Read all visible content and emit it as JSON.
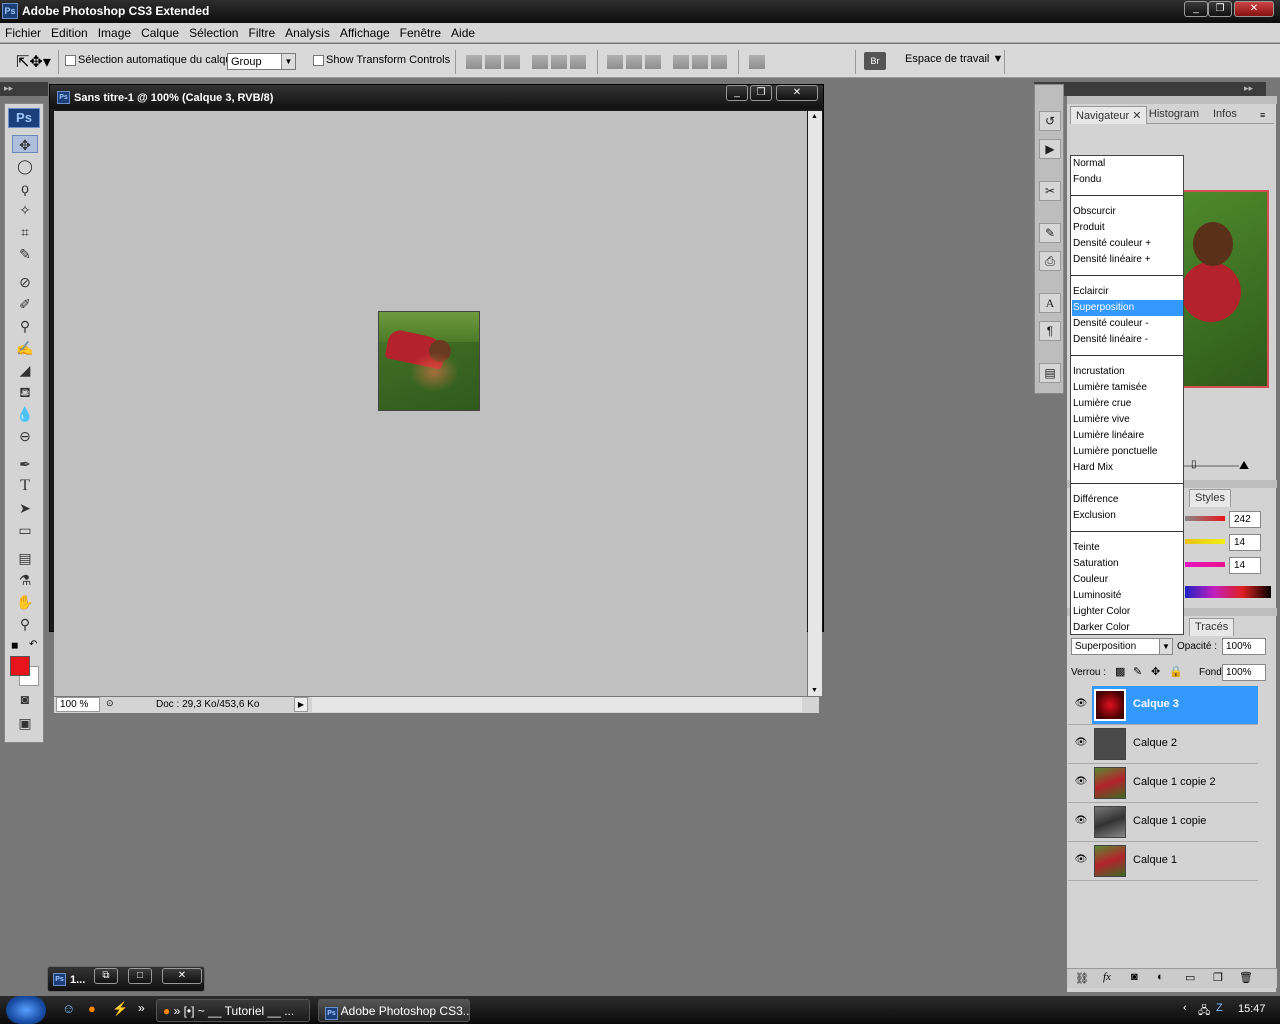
{
  "app": {
    "title": "Adobe Photoshop CS3 Extended",
    "logo": "Ps"
  },
  "menu": [
    "Fichier",
    "Edition",
    "Image",
    "Calque",
    "Sélection",
    "Filtre",
    "Analysis",
    "Affichage",
    "Fenêtre",
    "Aide"
  ],
  "options": {
    "auto_select_label": "Sélection automatique du calque",
    "auto_select_value": "Group",
    "transform_label": "Show Transform Controls",
    "workspace_label": "Espace de travail"
  },
  "document": {
    "title": "Sans titre-1 @ 100% (Calque 3, RVB/8)",
    "zoom": "100 %",
    "doc_info": "Doc : 29,3 Ko/453,6 Ko"
  },
  "navigator": {
    "tabs": [
      "Navigateur",
      "Histogram",
      "Infos"
    ]
  },
  "color": {
    "tab": "Styles",
    "values": [
      "242",
      "14",
      "14"
    ]
  },
  "blend_menu": {
    "groups": [
      [
        "Normal",
        "Fondu"
      ],
      [
        "Obscurcir",
        "Produit",
        "Densité couleur +",
        "Densité linéaire +"
      ],
      [
        "Eclaircir",
        "Superposition",
        "Densité couleur -",
        "Densité linéaire -"
      ],
      [
        "Incrustation",
        "Lumière tamisée",
        "Lumière crue",
        "Lumière vive",
        "Lumière linéaire",
        "Lumière ponctuelle",
        "Hard Mix"
      ],
      [
        "Différence",
        "Exclusion"
      ],
      [
        "Teinte",
        "Saturation",
        "Couleur",
        "Luminosité",
        "Lighter Color",
        "Darker Color"
      ]
    ],
    "selected": "Superposition"
  },
  "layers": {
    "tab": "Tracés",
    "blend_mode": "Superposition",
    "opacity_label": "Opacité :",
    "opacity": "100%",
    "lock_label": "Verrou :",
    "fill_label": "Fond :",
    "fill": "100%",
    "items": [
      {
        "name": "Calque 3",
        "selected": true
      },
      {
        "name": "Calque 2"
      },
      {
        "name": "Calque 1 copie 2"
      },
      {
        "name": "Calque 1 copie"
      },
      {
        "name": "Calque 1"
      }
    ]
  },
  "minimized": {
    "label": "1..."
  },
  "taskbar": {
    "item1": "» [•] ~ __ Tutoriel __ ...",
    "item2": "Adobe Photoshop CS3...",
    "clock": "15:47"
  },
  "colors": {
    "accent": "#3399ff",
    "foreground": "#e8141c"
  }
}
